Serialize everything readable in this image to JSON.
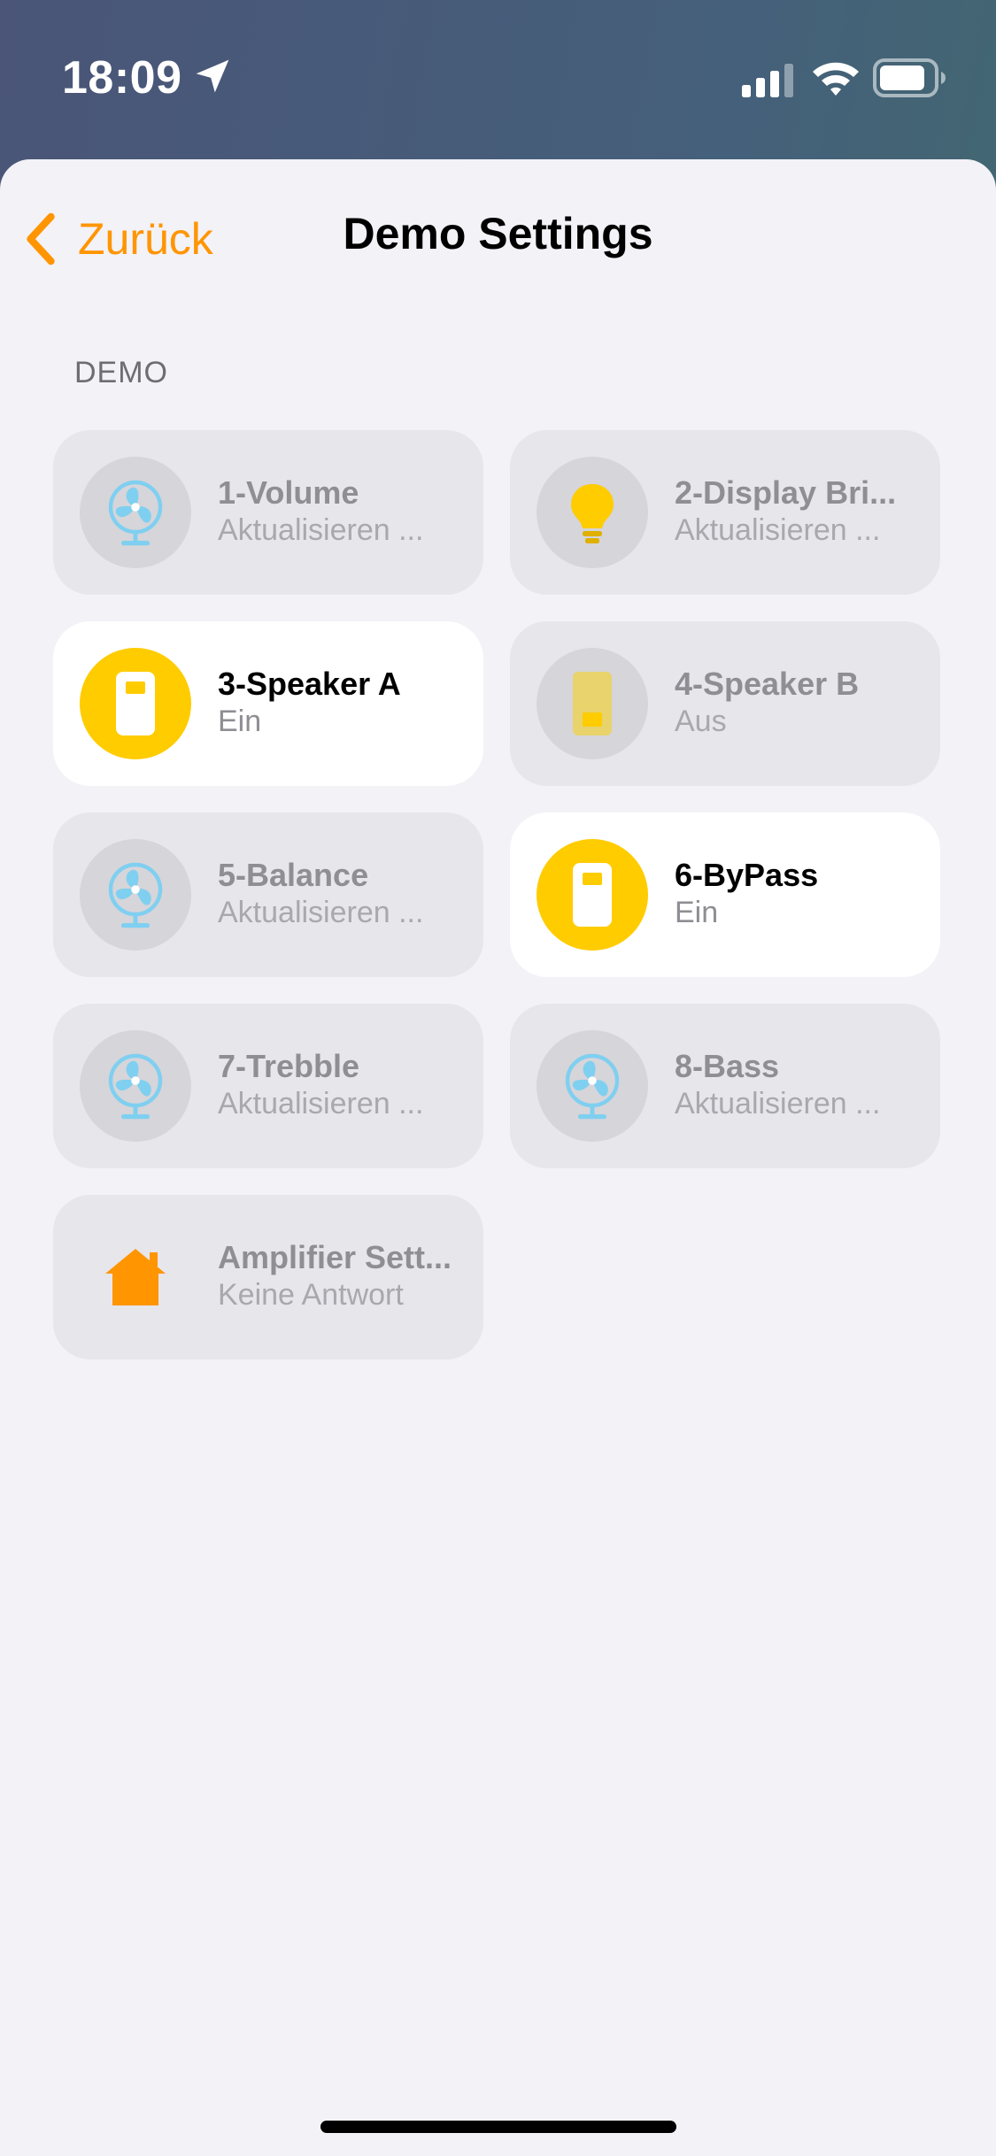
{
  "status_bar": {
    "time": "18:09"
  },
  "nav": {
    "back_label": "Zurück",
    "title": "Demo Settings"
  },
  "section": {
    "header": "DEMO"
  },
  "tiles": [
    {
      "name": "1-Volume",
      "status": "Aktualisieren ...",
      "icon": "fan-icon",
      "state": "off"
    },
    {
      "name": "2-Display Bri...",
      "status": "Aktualisieren ...",
      "icon": "lightbulb-icon",
      "state": "off"
    },
    {
      "name": "3-Speaker A",
      "status": "Ein",
      "icon": "switch-icon",
      "state": "on"
    },
    {
      "name": "4-Speaker B",
      "status": "Aus",
      "icon": "switch-icon",
      "state": "off"
    },
    {
      "name": "5-Balance",
      "status": "Aktualisieren ...",
      "icon": "fan-icon",
      "state": "off"
    },
    {
      "name": "6-ByPass",
      "status": "Ein",
      "icon": "switch-icon",
      "state": "on"
    },
    {
      "name": "7-Trebble",
      "status": "Aktualisieren ...",
      "icon": "fan-icon",
      "state": "off"
    },
    {
      "name": "8-Bass",
      "status": "Aktualisieren ...",
      "icon": "fan-icon",
      "state": "off"
    },
    {
      "name": "Amplifier Sett...",
      "status": "Keine Antwort",
      "icon": "house-icon",
      "state": "no-response"
    }
  ],
  "colors": {
    "accent": "#ff9500",
    "active": "#ffcc00",
    "fan": "#7fcff0",
    "house": "#ff9500"
  }
}
